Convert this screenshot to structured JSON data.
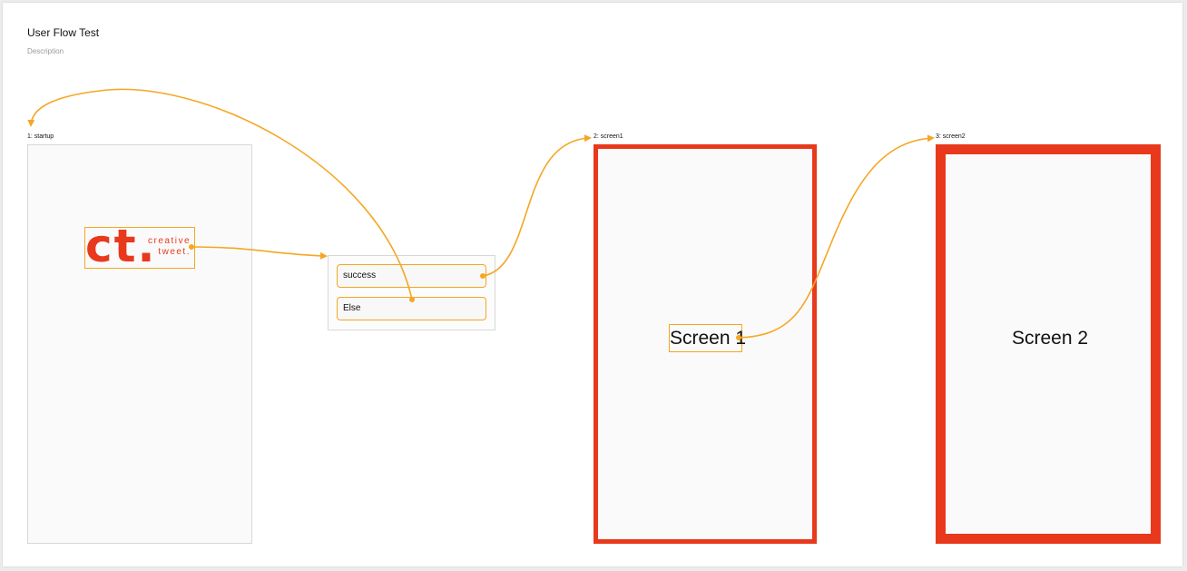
{
  "header": {
    "title": "User Flow Test",
    "description": "Description"
  },
  "frames": {
    "startup": {
      "label": "1: startup"
    },
    "screen1": {
      "label": "2: screen1",
      "text": "Screen 1"
    },
    "screen2": {
      "label": "3: screen2",
      "text": "Screen 2"
    }
  },
  "logo": {
    "mark": "ct.",
    "line1": "creative",
    "line2": "tweet."
  },
  "decision": {
    "options": [
      "success",
      "Else"
    ]
  },
  "colors": {
    "connector": "#f5a623",
    "accent_red": "#e8391d"
  }
}
